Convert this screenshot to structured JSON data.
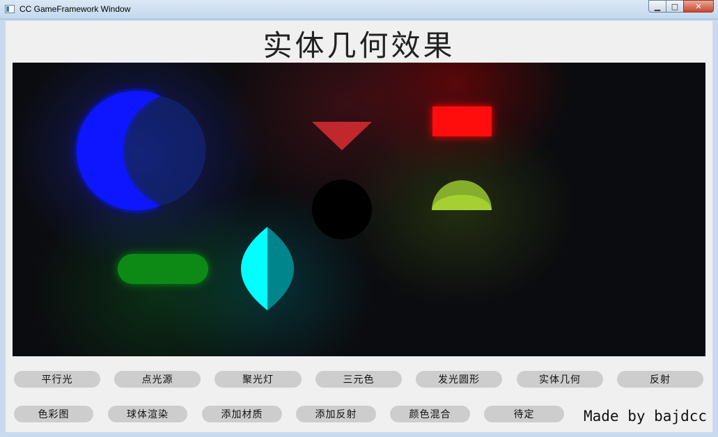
{
  "window": {
    "title": "CC GameFramework Window",
    "minimize_icon": "minimize-icon",
    "maximize_icon": "maximize-icon",
    "close_icon": "close-icon"
  },
  "page": {
    "title": "实体几何效果"
  },
  "scene": {
    "shapes": [
      {
        "name": "crescent-moon-shape",
        "color": "#0a16ff"
      },
      {
        "name": "triangle-shape",
        "color": "#c0282c"
      },
      {
        "name": "rectangle-shape",
        "color": "#ff0a0a"
      },
      {
        "name": "black-circle-shape",
        "color": "#000000"
      },
      {
        "name": "semicircle-shape",
        "color": "#9fc92e"
      },
      {
        "name": "capsule-shape",
        "color": "#0a8a16"
      },
      {
        "name": "lens-shape",
        "colors": [
          "#00ffff",
          "#00858c"
        ]
      }
    ]
  },
  "buttons_row1": [
    "平行光",
    "点光源",
    "聚光灯",
    "三元色",
    "发光圆形",
    "实体几何",
    "反射"
  ],
  "buttons_row2": [
    "色彩图",
    "球体渲染",
    "添加材质",
    "添加反射",
    "颜色混合",
    "待定"
  ],
  "signature": "Made by bajdcc"
}
